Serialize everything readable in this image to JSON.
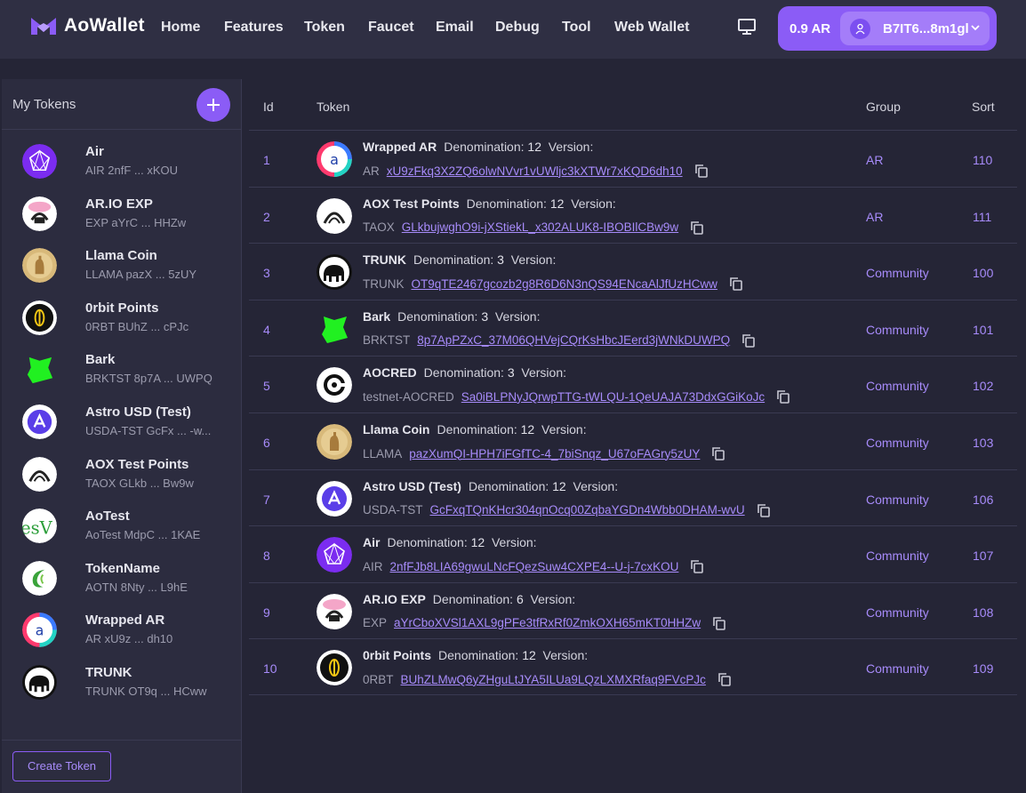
{
  "header": {
    "app_name": "AoWallet",
    "nav": [
      "Home",
      "Features",
      "Token",
      "Faucet",
      "Email",
      "Debug",
      "Tool",
      "Web Wallet"
    ],
    "balance": "0.9 AR",
    "address": "B7IT6...8m1gl",
    "accent": "#8b5cf6"
  },
  "sidebar": {
    "title": "My Tokens",
    "create_label": "Create Token",
    "items": [
      {
        "name": "Air",
        "sub": "AIR 2nfF ... xKOU",
        "icon": "air-icon"
      },
      {
        "name": "AR.IO EXP",
        "sub": "EXP aYrC ... HHZw",
        "icon": "ario-icon"
      },
      {
        "name": "Llama Coin",
        "sub": "LLAMA pazX ... 5zUY",
        "icon": "llama-icon"
      },
      {
        "name": "0rbit Points",
        "sub": "0RBT BUhZ ... cPJc",
        "icon": "orbit-icon"
      },
      {
        "name": "Bark",
        "sub": "BRKTST 8p7A ... UWPQ",
        "icon": "bark-icon"
      },
      {
        "name": "Astro USD (Test)",
        "sub": "USDA-TST GcFx ... -w...",
        "icon": "astro-icon"
      },
      {
        "name": "AOX Test Points",
        "sub": "TAOX GLkb ... Bw9w",
        "icon": "aox-icon"
      },
      {
        "name": "AoTest",
        "sub": "AoTest MdpC ... 1KAE",
        "icon": "aotest-icon"
      },
      {
        "name": "TokenName",
        "sub": "AOTN 8Nty ... L9hE",
        "icon": "tokenname-icon"
      },
      {
        "name": "Wrapped AR",
        "sub": "AR xU9z ... dh10",
        "icon": "wrapped-ar-icon"
      },
      {
        "name": "TRUNK",
        "sub": "TRUNK OT9q ... HCww",
        "icon": "trunk-icon"
      }
    ]
  },
  "table": {
    "headers": {
      "id": "Id",
      "token": "Token",
      "group": "Group",
      "sort": "Sort"
    },
    "denom_label": "Denomination:",
    "version_label": "Version:",
    "rows": [
      {
        "id": "1",
        "name": "Wrapped AR",
        "denom": "12",
        "ticker": "AR",
        "pid": "xU9zFkq3X2ZQ6olwNVvr1vUWljc3kXTWr7xKQD6dh10",
        "group": "AR",
        "sort": "110",
        "icon": "wrapped-ar-icon"
      },
      {
        "id": "2",
        "name": "AOX Test Points",
        "denom": "12",
        "ticker": "TAOX",
        "pid": "GLkbujwghO9i-jXStiekL_x302ALUK8-IBOBIlCBw9w",
        "group": "AR",
        "sort": "111",
        "icon": "aox-icon"
      },
      {
        "id": "3",
        "name": "TRUNK",
        "denom": "3",
        "ticker": "TRUNK",
        "pid": "OT9qTE2467gcozb2g8R6D6N3nQS94ENcaAlJfUzHCww",
        "group": "Community",
        "sort": "100",
        "icon": "trunk-icon"
      },
      {
        "id": "4",
        "name": "Bark",
        "denom": "3",
        "ticker": "BRKTST",
        "pid": "8p7ApPZxC_37M06QHVejCQrKsHbcJEerd3jWNkDUWPQ",
        "group": "Community",
        "sort": "101",
        "icon": "bark-icon"
      },
      {
        "id": "5",
        "name": "AOCRED",
        "denom": "3",
        "ticker": "testnet-AOCRED",
        "pid": "Sa0iBLPNyJQrwpTTG-tWLQU-1QeUAJA73DdxGGiKoJc",
        "group": "Community",
        "sort": "102",
        "icon": "aocred-icon"
      },
      {
        "id": "6",
        "name": "Llama Coin",
        "denom": "12",
        "ticker": "LLAMA",
        "pid": "pazXumQI-HPH7iFGfTC-4_7biSnqz_U67oFAGry5zUY",
        "group": "Community",
        "sort": "103",
        "icon": "llama-icon"
      },
      {
        "id": "7",
        "name": "Astro USD (Test)",
        "denom": "12",
        "ticker": "USDA-TST",
        "pid": "GcFxqTQnKHcr304qnOcq00ZqbaYGDn4Wbb0DHAM-wvU",
        "group": "Community",
        "sort": "106",
        "icon": "astro-icon"
      },
      {
        "id": "8",
        "name": "Air",
        "denom": "12",
        "ticker": "AIR",
        "pid": "2nfFJb8LIA69gwuLNcFQezSuw4CXPE4--U-j-7cxKOU",
        "group": "Community",
        "sort": "107",
        "icon": "air-icon"
      },
      {
        "id": "9",
        "name": "AR.IO EXP",
        "denom": "6",
        "ticker": "EXP",
        "pid": "aYrCboXVSl1AXL9gPFe3tfRxRf0ZmkOXH65mKT0HHZw",
        "group": "Community",
        "sort": "108",
        "icon": "ario-icon"
      },
      {
        "id": "10",
        "name": "0rbit Points",
        "denom": "12",
        "ticker": "0RBT",
        "pid": "BUhZLMwQ6yZHguLtJYA5ILUa9LQzLXMXRfaq9FVcPJc",
        "group": "Community",
        "sort": "109",
        "icon": "orbit-icon"
      }
    ]
  }
}
